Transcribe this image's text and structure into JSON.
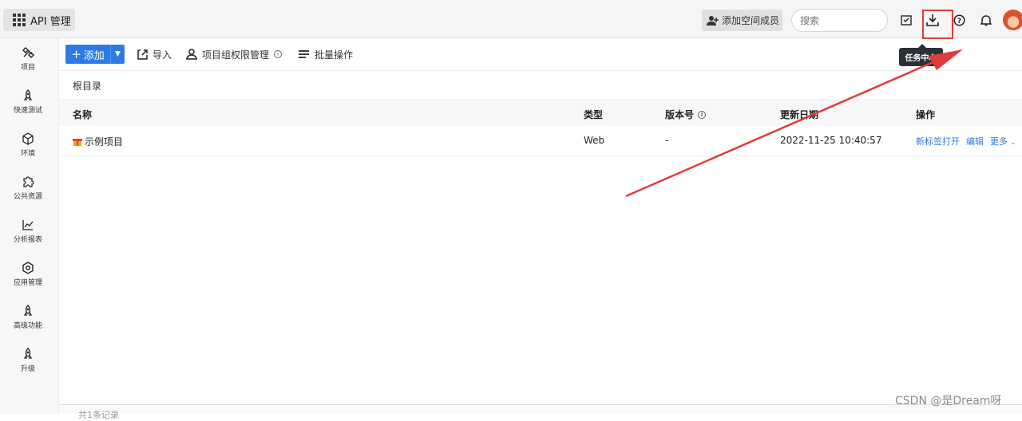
{
  "topbar": {
    "app_title": "API 管理",
    "invite_label": "添加空间成员",
    "search_placeholder": "搜索",
    "tooltip": "任务中心"
  },
  "sidebar": {
    "items": [
      {
        "label": "项目",
        "icon": "project-icon",
        "active": true
      },
      {
        "label": "快速测试",
        "icon": "rocket-icon"
      },
      {
        "label": "环境",
        "icon": "environment-icon"
      },
      {
        "label": "公共资源",
        "icon": "puzzle-icon"
      },
      {
        "label": "分析报表",
        "icon": "chart-icon"
      },
      {
        "label": "应用管理",
        "icon": "gear-icon"
      },
      {
        "label": "高级功能",
        "icon": "rocket-icon"
      },
      {
        "label": "升级",
        "icon": "rocket-icon"
      }
    ]
  },
  "toolbar": {
    "add_label": "添加",
    "import_label": "导入",
    "permission_label": "项目组权限管理",
    "batch_label": "批量操作"
  },
  "breadcrumb": "根目录",
  "table": {
    "columns": [
      "名称",
      "类型",
      "版本号",
      "更新日期",
      "操作"
    ],
    "rows": [
      {
        "name": "示例项目",
        "type": "Web",
        "version": "-",
        "updated": "2022-11-25 10:40:57",
        "actions": [
          "新标签打开",
          "编辑",
          "更多"
        ]
      }
    ]
  },
  "footer": {
    "count_text": "共1条记录"
  },
  "watermark": "CSDN @是Dream呀",
  "colors": {
    "accent": "#2c7be5",
    "highlight": "#e23b3b"
  }
}
